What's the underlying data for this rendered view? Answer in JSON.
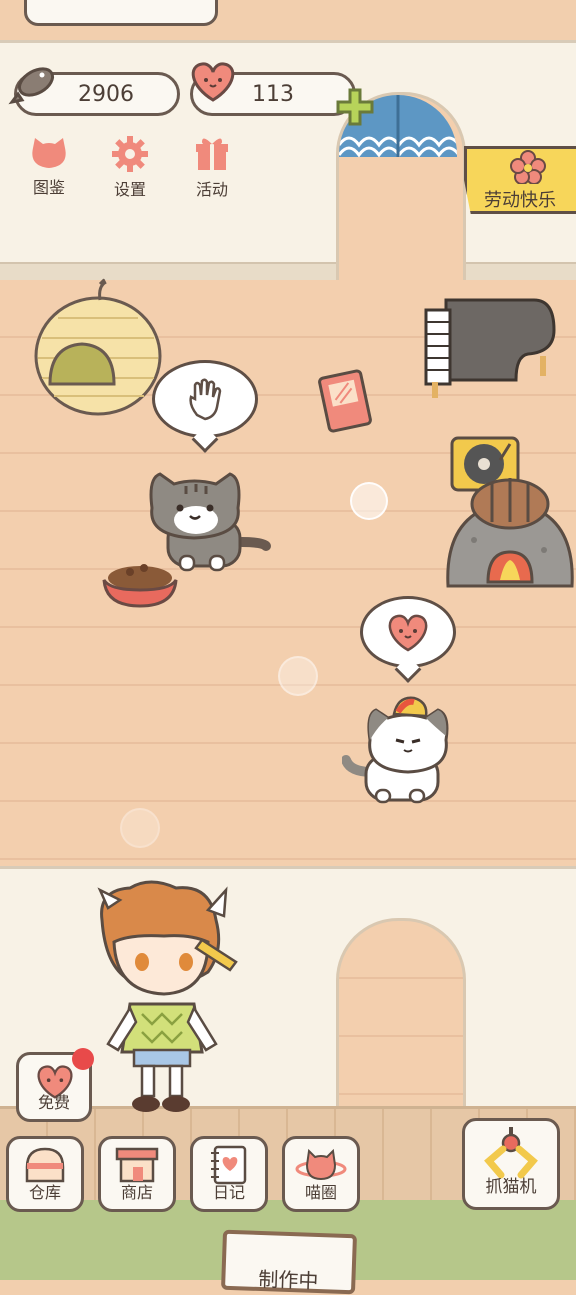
{
  "currency": {
    "fish_count": "2906",
    "heart_count": "113"
  },
  "top_menu": [
    {
      "label": "图鉴",
      "icon": "cat-face-icon"
    },
    {
      "label": "设置",
      "icon": "gear-icon"
    },
    {
      "label": "活动",
      "icon": "gift-icon"
    }
  ],
  "event_banner": {
    "label": "劳动快乐"
  },
  "free_button": {
    "label": "免费"
  },
  "bottom_menu": [
    {
      "label": "仓库",
      "icon": "storage-icon"
    },
    {
      "label": "商店",
      "icon": "shop-icon"
    },
    {
      "label": "日记",
      "icon": "diary-icon"
    },
    {
      "label": "喵圈",
      "icon": "planet-cat-icon"
    }
  ],
  "claw_machine": {
    "label": "抓猫机",
    "icon": "claw-icon"
  },
  "crafting_sign": {
    "label": "制作中"
  },
  "colors": {
    "wall": "#f8f2e6",
    "floor": "#f3cfae",
    "accent_pink": "#f08a7c",
    "banner_yellow": "#f7d65a",
    "grass": "#b6c78a",
    "outline": "#6a5a50"
  }
}
